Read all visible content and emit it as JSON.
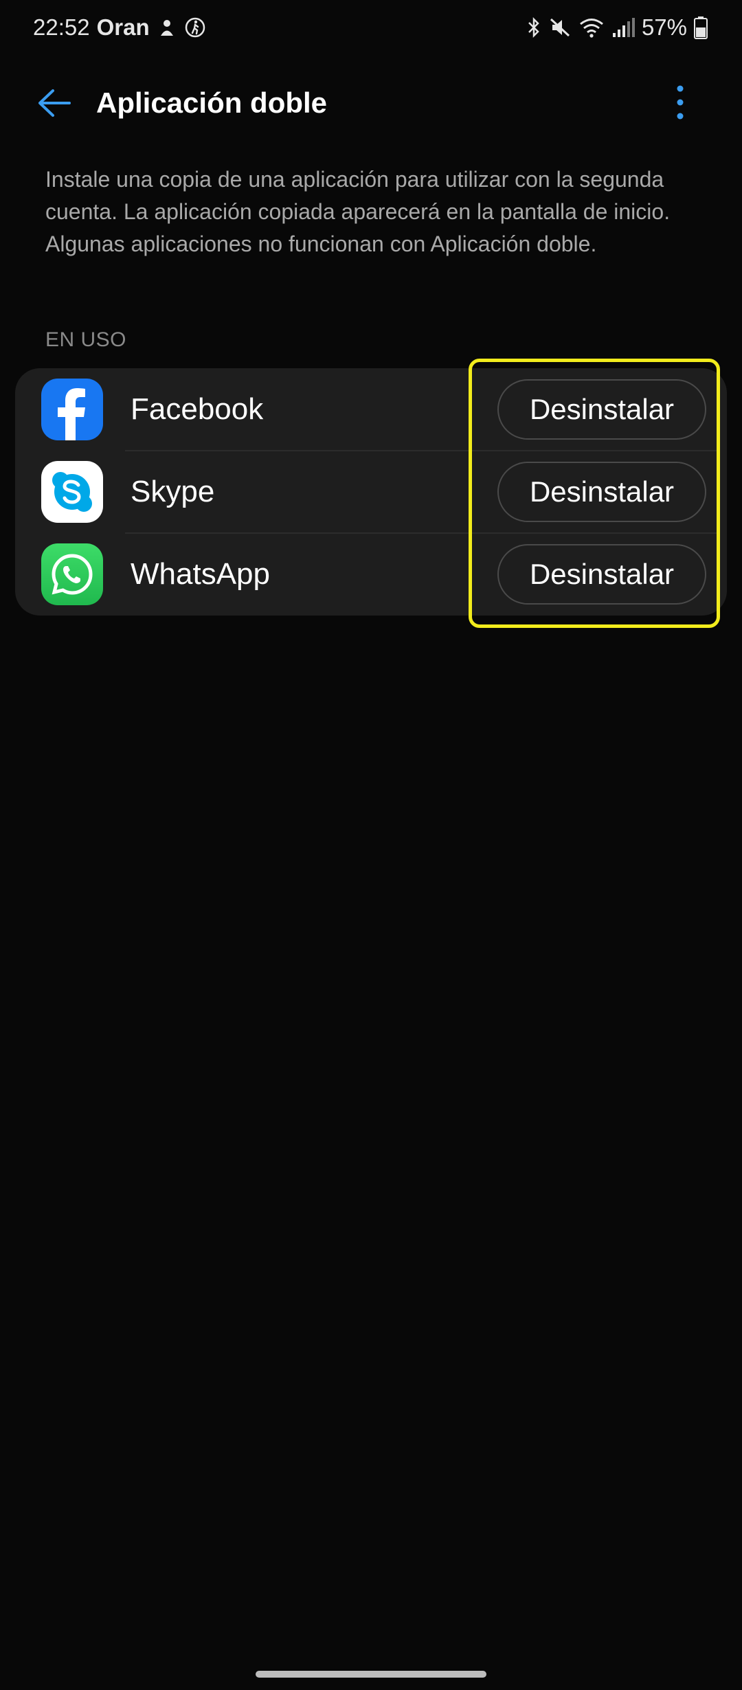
{
  "status_bar": {
    "time": "22:52",
    "carrier": "Oran",
    "battery_percent": "57%",
    "icons": [
      "bluetooth-icon",
      "mute-icon",
      "wifi-icon",
      "signal-icon",
      "battery-icon"
    ]
  },
  "header": {
    "title": "Aplicación doble",
    "back_icon": "arrow-left-icon",
    "more_icon": "more-vertical-icon"
  },
  "description": "Instale una copia de una aplicación para utilizar con la segunda cuenta. La aplicación copiada aparecerá en la pantalla de inicio. Algunas aplicaciones no funcionan con Aplicación doble.",
  "section": {
    "label": "EN USO"
  },
  "apps": [
    {
      "name": "Facebook",
      "action": "Desinstalar",
      "icon": "facebook-icon"
    },
    {
      "name": "Skype",
      "action": "Desinstalar",
      "icon": "skype-icon"
    },
    {
      "name": "WhatsApp",
      "action": "Desinstalar",
      "icon": "whatsapp-icon"
    }
  ],
  "colors": {
    "background": "#080808",
    "card": "#1e1e1e",
    "accent": "#3b9df0",
    "highlight": "#f2ec1c",
    "facebook": "#1877f2",
    "skype": "#00a8e8",
    "whatsapp": "#25d366"
  }
}
